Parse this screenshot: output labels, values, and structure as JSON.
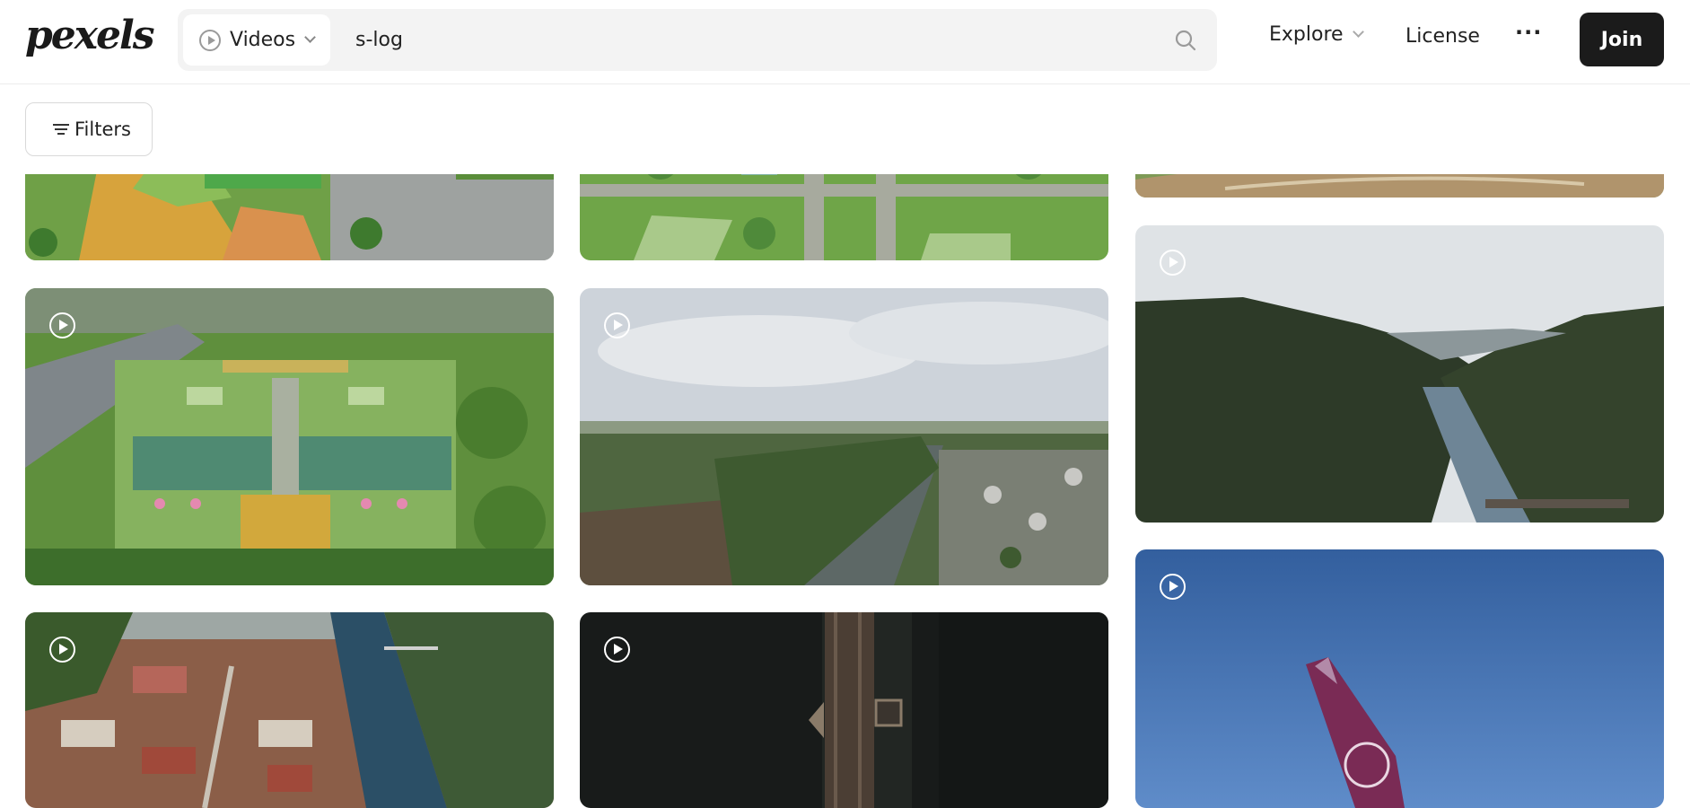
{
  "header": {
    "logo": "pexels",
    "search": {
      "type_label": "Videos",
      "query": "s-log"
    },
    "nav": {
      "explore": "Explore",
      "license": "License",
      "more": "···",
      "join": "Join"
    }
  },
  "toolbar": {
    "filters_label": "Filters"
  },
  "videos": [
    {
      "id": "col1-top",
      "scene": "aerial pagoda temple complex",
      "colors": [
        "#7aa84a",
        "#d4a43a"
      ]
    },
    {
      "id": "col2-top",
      "scene": "aerial temple gardens",
      "colors": [
        "#7bb34c",
        "#a2b784"
      ]
    },
    {
      "id": "col3-top",
      "scene": "aerial grounds",
      "colors": [
        "#7c9a52",
        "#a88e68"
      ]
    },
    {
      "id": "col1-mid",
      "scene": "aerial temple complex with lake",
      "colors": [
        "#5b8a3a",
        "#8fb166"
      ]
    },
    {
      "id": "col2-mid",
      "scene": "river canal through fields",
      "colors": [
        "#c9ced4",
        "#4d5a45"
      ]
    },
    {
      "id": "col3-mid",
      "scene": "river valley between hills",
      "colors": [
        "#dde2e6",
        "#2e3a28"
      ]
    },
    {
      "id": "col1-bot",
      "scene": "aerial old town by river",
      "colors": [
        "#8a5a44",
        "#2c4a5e"
      ]
    },
    {
      "id": "col2-bot",
      "scene": "bridge over dark river",
      "colors": [
        "#1a1d1c",
        "#4a3c32"
      ]
    },
    {
      "id": "col3-bot",
      "scene": "airplane wing against blue sky",
      "colors": [
        "#3f6fb2",
        "#7a2a52"
      ]
    }
  ]
}
